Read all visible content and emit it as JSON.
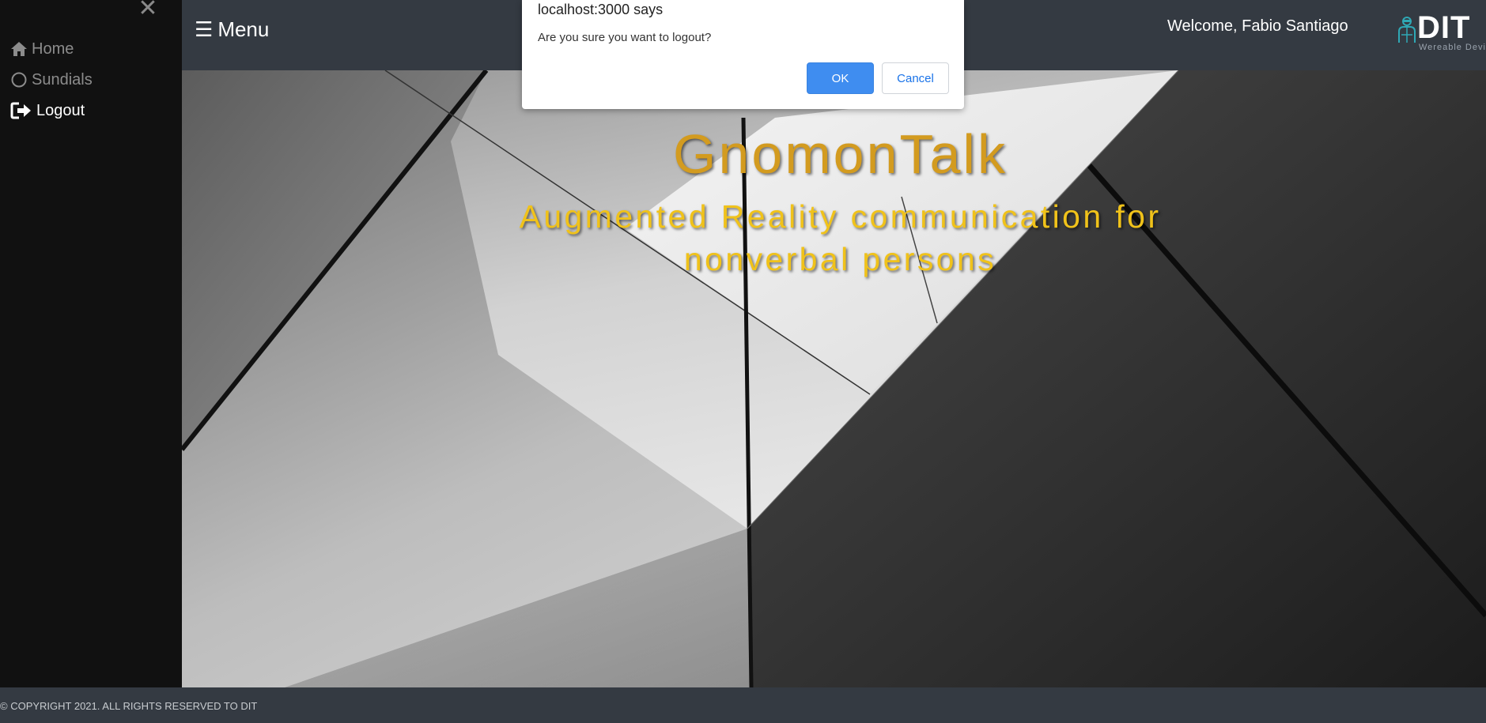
{
  "sidebar": {
    "close_glyph": "✕",
    "items": [
      {
        "label": "Home",
        "icon": "home-icon",
        "active": false
      },
      {
        "label": "Sundials",
        "icon": "circle-icon",
        "active": false
      },
      {
        "label": "Logout",
        "icon": "logout-icon",
        "active": true
      }
    ]
  },
  "header": {
    "menu_glyph": "☰",
    "menu_label": "Menu",
    "welcome": "Welcome, Fabio Santiago",
    "logo": {
      "text": "DIT",
      "subtitle": "Wereable Device"
    }
  },
  "hero": {
    "title": "GnomonTalk",
    "subtitle": "Augmented Reality communication for nonverbal persons"
  },
  "footer": {
    "copyright": "© COPYRIGHT 2021. ALL RIGHTS RESERVED TO DIT"
  },
  "dialog": {
    "title": "localhost:3000 says",
    "message": "Are you sure you want to logout?",
    "ok_label": "OK",
    "cancel_label": "Cancel"
  },
  "colors": {
    "header_bg": "#343a42",
    "sidebar_bg": "#111111",
    "title_gold": "#d39b1f",
    "subtitle_gold": "#f0c21a",
    "ok_blue": "#3f8df0"
  }
}
